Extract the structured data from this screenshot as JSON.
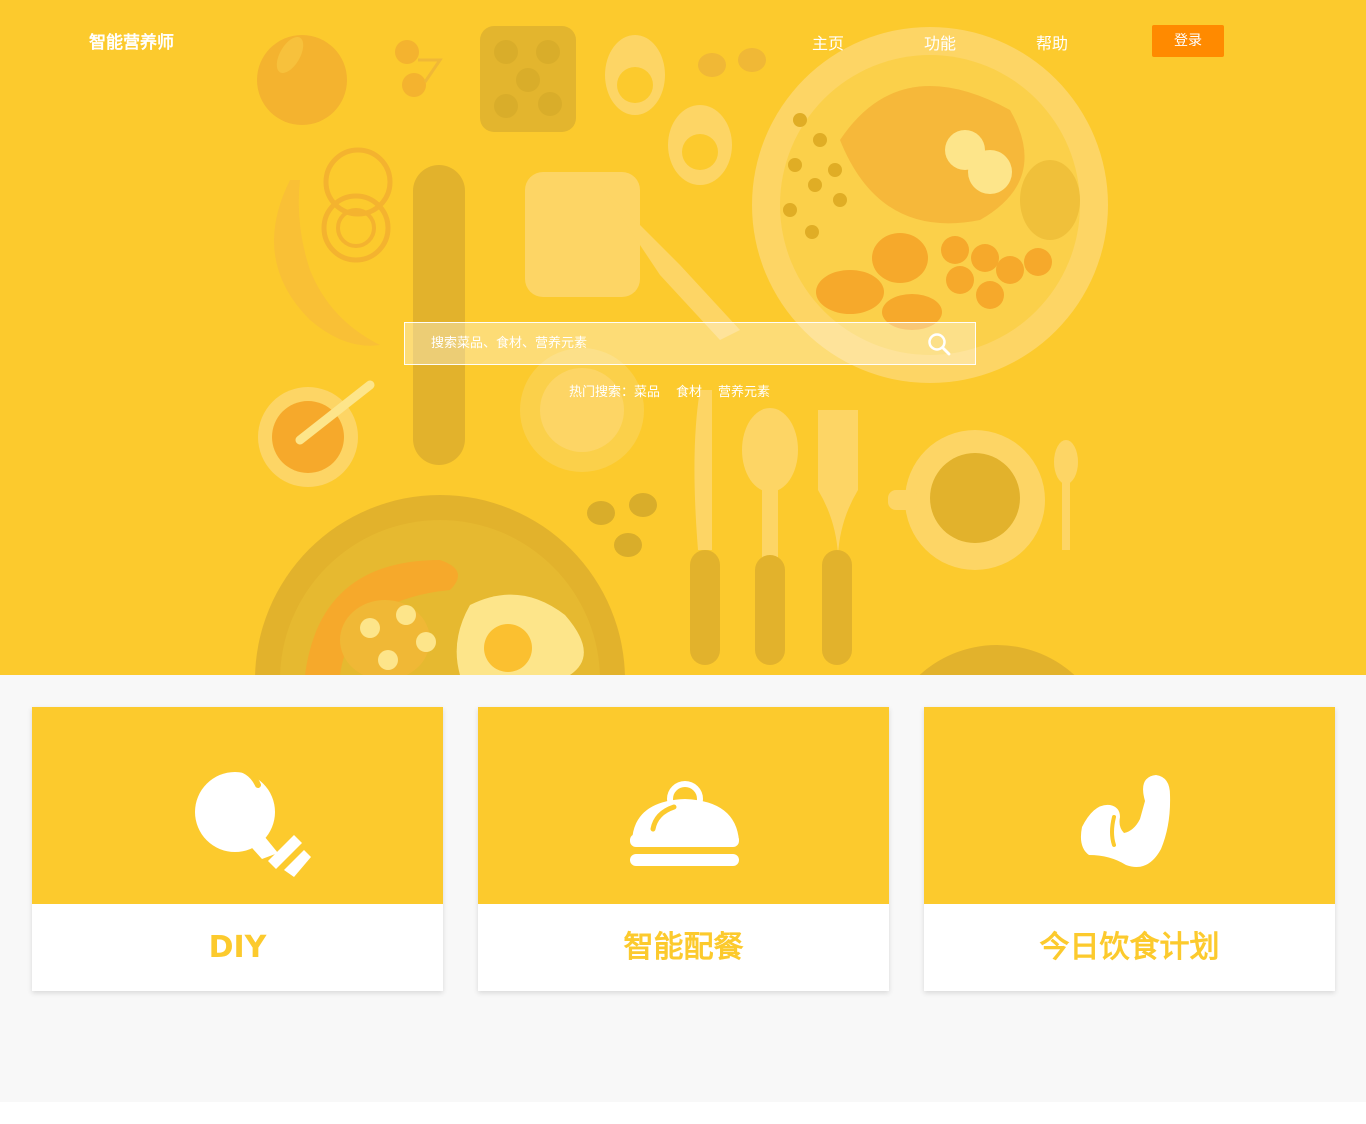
{
  "colors": {
    "brand_yellow": "#fcca2d",
    "login_orange": "#ff8a00",
    "section_bg": "#f8f8f8"
  },
  "header": {
    "brand": "智能营养师",
    "nav": [
      "主页",
      "功能",
      "帮助"
    ],
    "login_label": "登录"
  },
  "search": {
    "placeholder": "搜索菜品、食材、营养元素",
    "value": "",
    "icon": "search-icon",
    "hot_prefix": "热门搜索：",
    "hot_links": [
      "菜品",
      "食材",
      "营养元素"
    ]
  },
  "features": [
    {
      "title": "DIY",
      "icon": "lightbulb-icon"
    },
    {
      "title": "智能配餐",
      "icon": "food-cloche-icon"
    },
    {
      "title": "今日饮食计划",
      "icon": "muscle-arm-icon"
    }
  ]
}
